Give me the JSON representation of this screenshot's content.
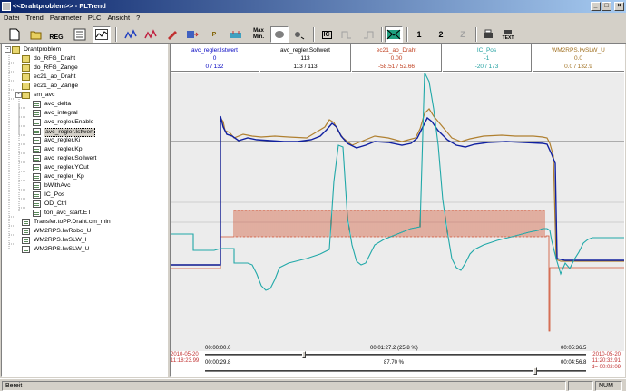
{
  "window": {
    "title": "<<Drahtproblem>> - PLTrend",
    "controls": [
      "_",
      "□",
      "×"
    ]
  },
  "menu": [
    "Datei",
    "Trend",
    "Parameter",
    "PLC",
    "Ansicht",
    "?"
  ],
  "toolbar": {
    "reg_label": "REG",
    "p_label": "P",
    "max_label": "Max",
    "min_label": "Min.",
    "ic_label": "IC",
    "cursor1_label": "1",
    "cursor2_label": "2",
    "cursor3_label": "Z",
    "text_label": "TEXT"
  },
  "tree": {
    "root": "Drahtproblem",
    "items": [
      {
        "label": "Drahtproblem",
        "type": "folder",
        "level": 0,
        "expanded": true
      },
      {
        "label": "do_RFG_Draht",
        "type": "folder",
        "level": 1
      },
      {
        "label": "do_RFG_Zange",
        "type": "folder",
        "level": 1
      },
      {
        "label": "ec21_ao_Draht",
        "type": "folder",
        "level": 1
      },
      {
        "label": "ec21_ao_Zange",
        "type": "folder",
        "level": 1
      },
      {
        "label": "sm_avc",
        "type": "folder",
        "level": 1,
        "expanded": true
      },
      {
        "label": "avc_delta",
        "type": "doc",
        "level": 2
      },
      {
        "label": "avc_integral",
        "type": "doc",
        "level": 2
      },
      {
        "label": "avc_regler.Enable",
        "type": "doc",
        "level": 2
      },
      {
        "label": "avc_regler.Istwert",
        "type": "doc",
        "level": 2,
        "selected": true
      },
      {
        "label": "avc_regler.Ki",
        "type": "doc",
        "level": 2
      },
      {
        "label": "avc_regler.Kp",
        "type": "doc",
        "level": 2
      },
      {
        "label": "avc_regler.Sollwert",
        "type": "doc",
        "level": 2
      },
      {
        "label": "avc_regler.YOut",
        "type": "doc",
        "level": 2
      },
      {
        "label": "avc_regler_Kp",
        "type": "doc",
        "level": 2
      },
      {
        "label": "bWithAvc",
        "type": "doc",
        "level": 2
      },
      {
        "label": "IC_Pos",
        "type": "doc",
        "level": 2
      },
      {
        "label": "OD_Ctrl",
        "type": "doc",
        "level": 2
      },
      {
        "label": "ton_avc_start.ET",
        "type": "doc",
        "level": 2
      },
      {
        "label": "Transfer.toPP.Draht.cm_min",
        "type": "doc",
        "level": 1
      },
      {
        "label": "WM2RPS.IwRobo_U",
        "type": "doc",
        "level": 1
      },
      {
        "label": "WM2RPS.IwSLW_I",
        "type": "doc",
        "level": 1
      },
      {
        "label": "WM2RPS.IwSLW_U",
        "type": "doc",
        "level": 1
      }
    ]
  },
  "headers": [
    {
      "name": "avc_regler.Istwert",
      "value": "0",
      "range": "0 / 132",
      "color": "#0000c0"
    },
    {
      "name": "avc_regler.Sollwert",
      "value": "113",
      "range": "113 / 113",
      "color": "#000000"
    },
    {
      "name": "ec21_ao_Draht",
      "value": "0.00",
      "range": "-58.51 / 52.66",
      "color": "#c04020"
    },
    {
      "name": "IC_Pos",
      "value": "-1",
      "range": "-20 / 173",
      "color": "#20a0a0"
    },
    {
      "name": "WM2RPS.IwSLW_U",
      "value": "0.0",
      "range": "0.0 / 132.9",
      "color": "#a07020"
    }
  ],
  "footer": {
    "start_date": "2010-05-20",
    "start_time": "11:18:23.99",
    "end_date": "2010-05-20",
    "end_time": "11:20:32.91",
    "duration": "d= 00:02:09",
    "t0": "00:00:00.0",
    "tmid": "00:01:27.2 (25.8 %)",
    "tend": "00:05:36.5",
    "view_start": "00:00:29.8",
    "zoom": "87.70 %",
    "view_end": "00:04:56.8"
  },
  "status": {
    "text": "Bereit",
    "num": "NUM"
  }
}
